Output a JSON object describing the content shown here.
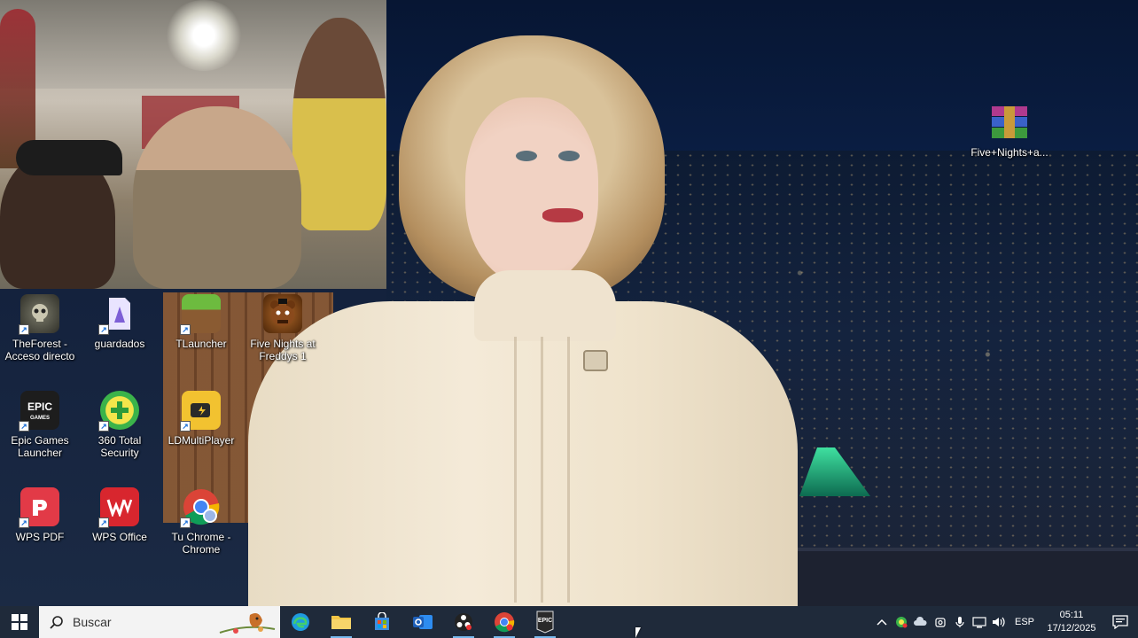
{
  "desktop": {
    "icons": [
      {
        "label": "TheForest - Acceso directo",
        "icon": "the-forest-icon",
        "color": "#3a3a3a"
      },
      {
        "label": "guardados",
        "icon": "guardados-icon",
        "color": "#8e7bd6"
      },
      {
        "label": "TLauncher",
        "icon": "tlauncher-icon",
        "color": "#5aa13b"
      },
      {
        "label": "Five Nights at Freddys 1",
        "icon": "freddy-icon",
        "color": "#8a4a1c"
      },
      {
        "label": "Epic Games Launcher",
        "icon": "epic-games-icon",
        "color": "#2a2a2a"
      },
      {
        "label": "360 Total Security",
        "icon": "total-security-icon",
        "color": "#3bb34a"
      },
      {
        "label": "LDMultiPlayer",
        "icon": "ldmultiplayer-icon",
        "color": "#f2c230"
      },
      {
        "label": "WPS PDF",
        "icon": "wps-pdf-icon",
        "color": "#e23a47"
      },
      {
        "label": "WPS Office",
        "icon": "wps-office-icon",
        "color": "#d8262e"
      },
      {
        "label": "Tu Chrome - Chrome",
        "icon": "chrome-icon",
        "color": "#4285f4"
      },
      {
        "label": "Five+Nights+a...",
        "icon": "winrar-icon",
        "color": "#a03a8a"
      }
    ]
  },
  "taskbar": {
    "search_placeholder": "Buscar",
    "apps": [
      {
        "name": "edge",
        "icon": "edge-icon",
        "color": "#1f9be0",
        "active": false
      },
      {
        "name": "file-explorer",
        "icon": "folder-icon",
        "color": "#f2c545",
        "active": true
      },
      {
        "name": "store",
        "icon": "store-icon",
        "color": "#3c8de0",
        "active": false
      },
      {
        "name": "outlook",
        "icon": "outlook-icon",
        "color": "#1e6fd0",
        "active": false
      },
      {
        "name": "obs",
        "icon": "obs-icon",
        "color": "#222222",
        "active": true
      },
      {
        "name": "chrome",
        "icon": "chrome-icon",
        "color": "#4285f4",
        "active": true
      },
      {
        "name": "epic-games",
        "icon": "epic-games-icon",
        "color": "#2a2a2a",
        "active": true
      }
    ],
    "language": "ESP",
    "time": "05:11",
    "date": "17/12/2025"
  }
}
